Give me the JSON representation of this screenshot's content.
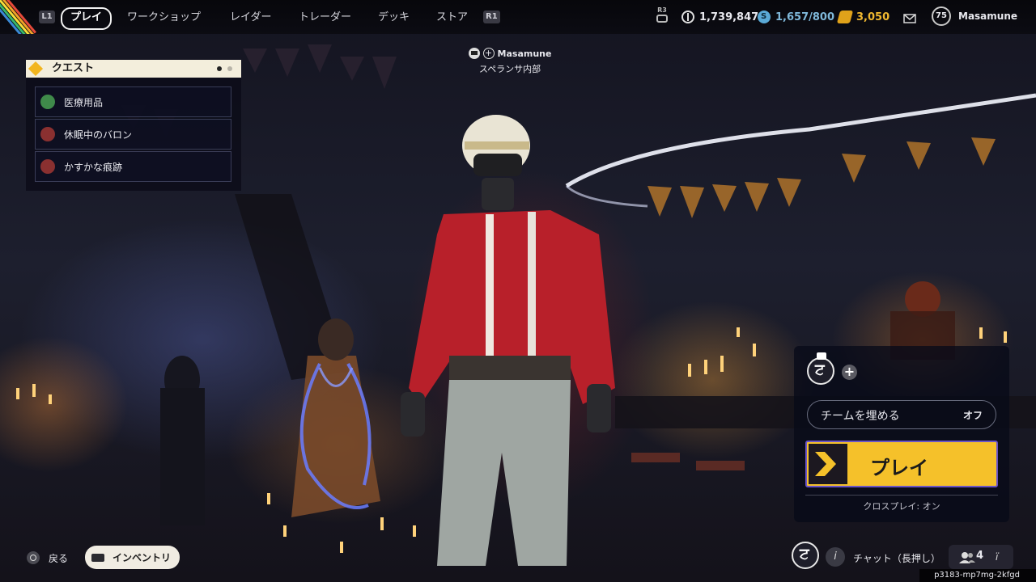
{
  "top_bar": {
    "left_bumper": "L1",
    "right_bumper": "R1",
    "tabs": [
      "プレイ",
      "ワークショップ",
      "レイダー",
      "トレーダー",
      "デッキ",
      "ストア"
    ],
    "r3_hint": "R3",
    "currency_1": "1,739,847",
    "currency_2": "1,657/800",
    "currency_3": "3,050",
    "level": "75",
    "username": "Masamune",
    "colors": {
      "coins_blue": "#5aa9d6",
      "gold": "#e0a21a"
    }
  },
  "quests": {
    "title": "クエスト",
    "items": [
      {
        "label": "医療用品",
        "icon": "medical-quest-icon",
        "color": "#3f8a4a"
      },
      {
        "label": "休眠中のバロン",
        "icon": "baron-quest-icon",
        "color": "#8a3030"
      },
      {
        "label": "かすかな痕跡",
        "icon": "trace-quest-icon",
        "color": "#8a3030"
      }
    ]
  },
  "player": {
    "name": "Masamune",
    "location": "スペランサ内部"
  },
  "party": {
    "fill_team_label": "チームを埋める",
    "fill_team_value": "オフ",
    "play_label": "プレイ",
    "crossplay": "クロスプレイ: オン",
    "colors": {
      "play": "#f5c12a",
      "play_border": "#6a55c8"
    }
  },
  "bottom": {
    "back_label": "戻る",
    "inventory_label": "インベントリ",
    "chat_label": "チャット（長押し）",
    "party_count": "4",
    "session_id": "p3183-mp7mg-2kfgd"
  }
}
